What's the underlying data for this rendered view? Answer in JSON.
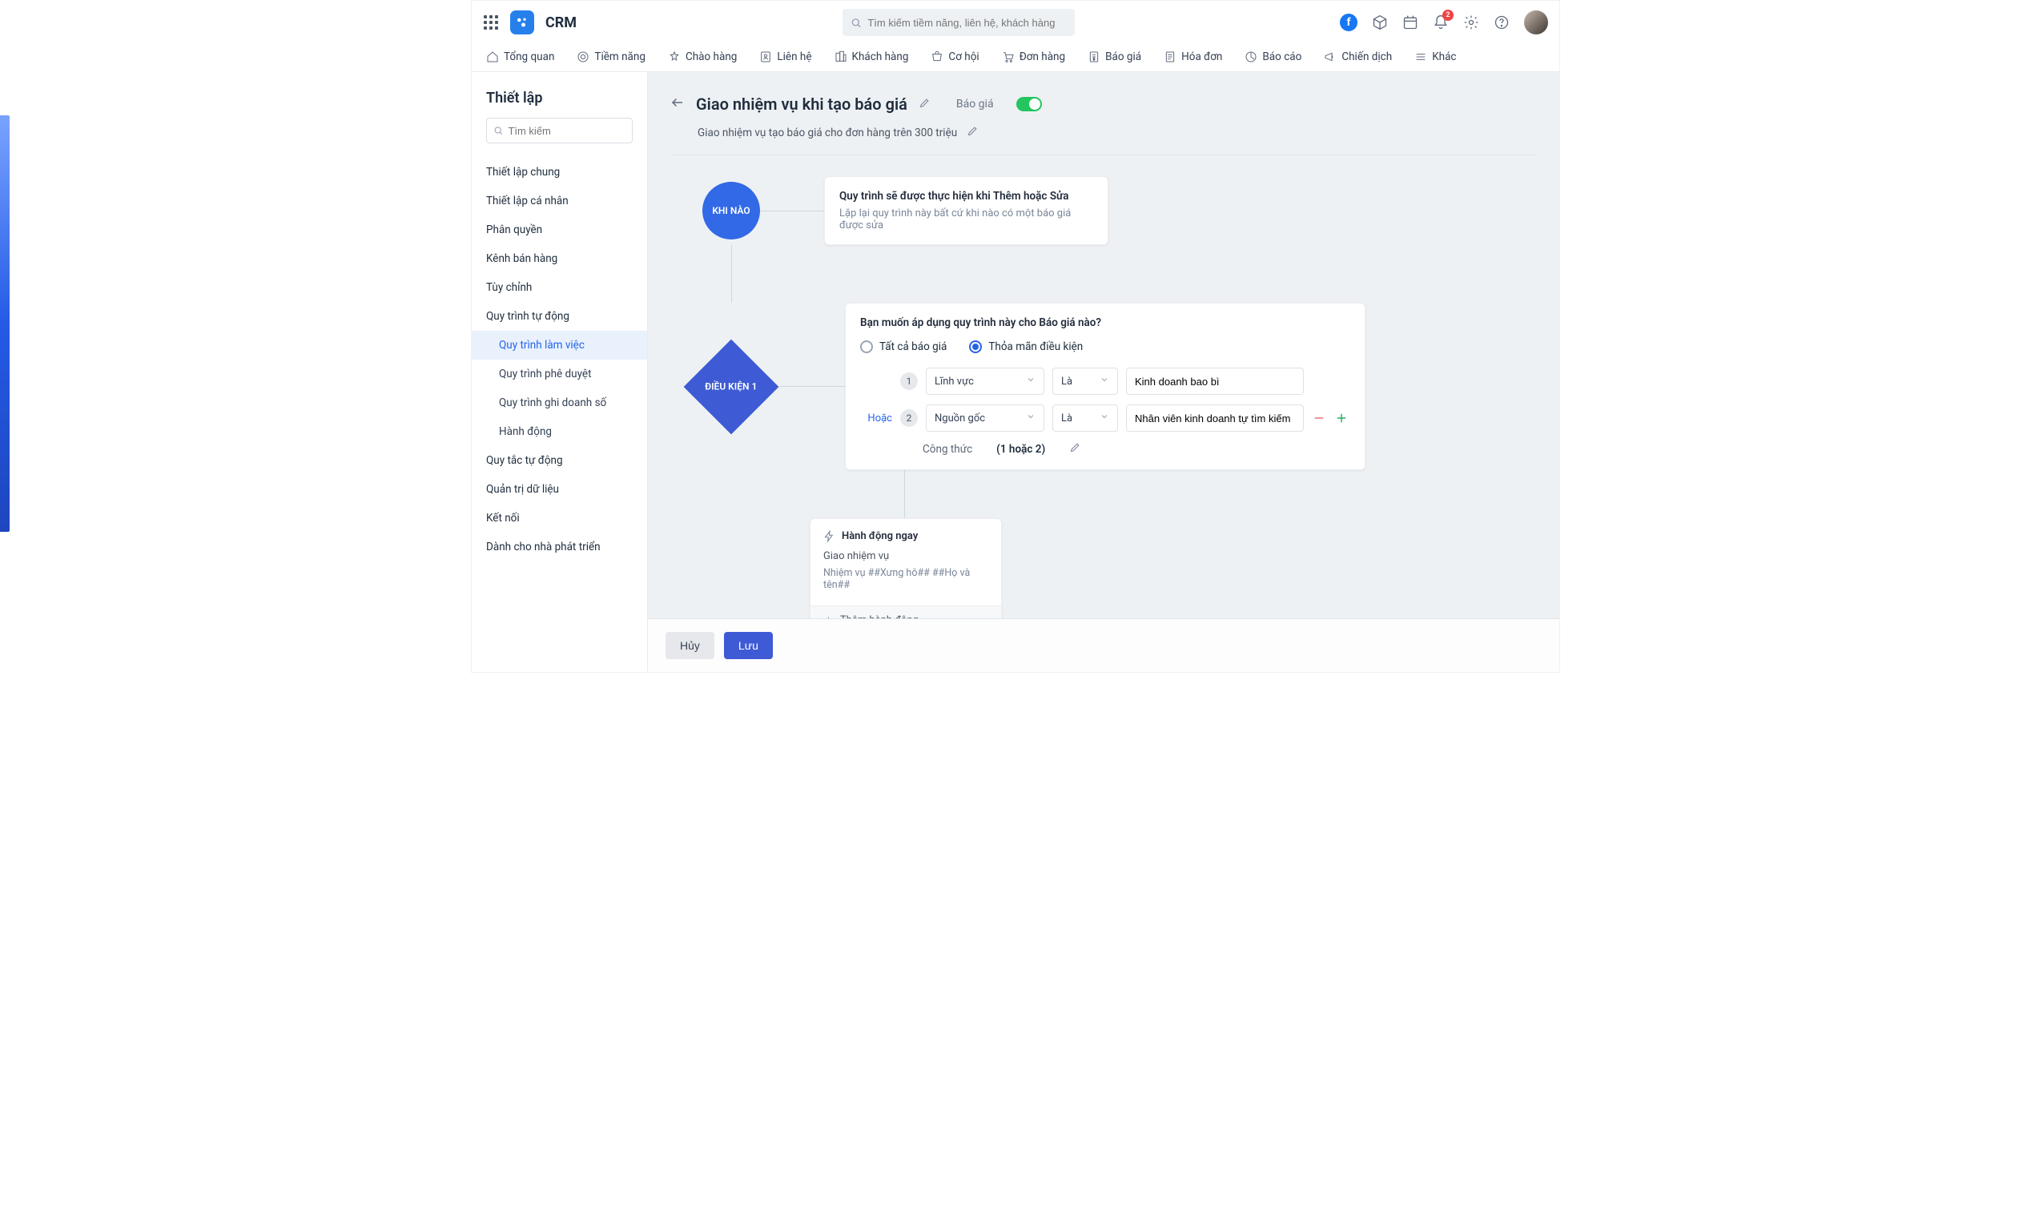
{
  "header": {
    "app_name": "CRM",
    "search_placeholder": "Tìm kiếm tiềm năng, liên hệ, khách hàng",
    "notif_count": "2"
  },
  "nav": {
    "items": [
      "Tổng quan",
      "Tiềm năng",
      "Chào hàng",
      "Liên hệ",
      "Khách hàng",
      "Cơ hội",
      "Đơn hàng",
      "Báo giá",
      "Hóa đơn",
      "Báo cáo",
      "Chiến dịch",
      "Khác"
    ]
  },
  "sidebar": {
    "title": "Thiết lập",
    "search_placeholder": "Tìm kiếm",
    "groups": [
      {
        "label": "Thiết lập chung"
      },
      {
        "label": "Thiết lập cá nhân"
      },
      {
        "label": "Phân quyền"
      },
      {
        "label": "Kênh bán hàng"
      },
      {
        "label": "Tùy chỉnh"
      },
      {
        "label": "Quy trình tự động"
      },
      {
        "label": "Quy trình làm việc",
        "sub": true,
        "active": true
      },
      {
        "label": "Quy trình phê duyệt",
        "sub": true
      },
      {
        "label": "Quy trình ghi doanh số",
        "sub": true
      },
      {
        "label": "Hành động",
        "sub": true
      },
      {
        "label": "Quy tắc tự động"
      },
      {
        "label": "Quản trị dữ liệu"
      },
      {
        "label": "Kết nối"
      },
      {
        "label": "Dành cho nhà phát triển"
      }
    ]
  },
  "page": {
    "title": "Giao nhiệm vụ khi tạo báo giá",
    "module": "Báo giá",
    "description": "Giao nhiệm vụ tạo báo giá cho đơn hàng trên 300 triệu"
  },
  "flow": {
    "when": {
      "label": "KHI NÀO",
      "line1": "Quy trình sẽ được thực hiện khi Thêm hoặc Sửa",
      "line2": "Lặp lại quy trình này bất cứ khi nào có một báo giá được sửa"
    },
    "condition": {
      "label": "ĐIỀU KIỆN 1",
      "prompt": "Bạn muốn áp dụng quy trình này cho Báo giá nào?",
      "options": {
        "all": "Tất cả báo giá",
        "match": "Thỏa mãn điều kiện"
      },
      "or_label": "Hoặc",
      "rows": [
        {
          "num": "1",
          "field": "Lĩnh vực",
          "op": "Là",
          "value": "Kinh doanh bao bì"
        },
        {
          "num": "2",
          "field": "Nguồn gốc",
          "op": "Là",
          "value": "Nhân viên kinh doanh tự tìm kiếm"
        }
      ],
      "formula_label": "Công thức",
      "formula_value": "(1 hoặc 2)"
    },
    "action": {
      "head": "Hành động ngay",
      "line1": "Giao nhiệm vụ",
      "line2": "Nhiệm vụ ##Xưng hô## ##Họ và tên##",
      "add": "Thêm hành động"
    }
  },
  "footer": {
    "cancel": "Hủy",
    "save": "Lưu"
  }
}
